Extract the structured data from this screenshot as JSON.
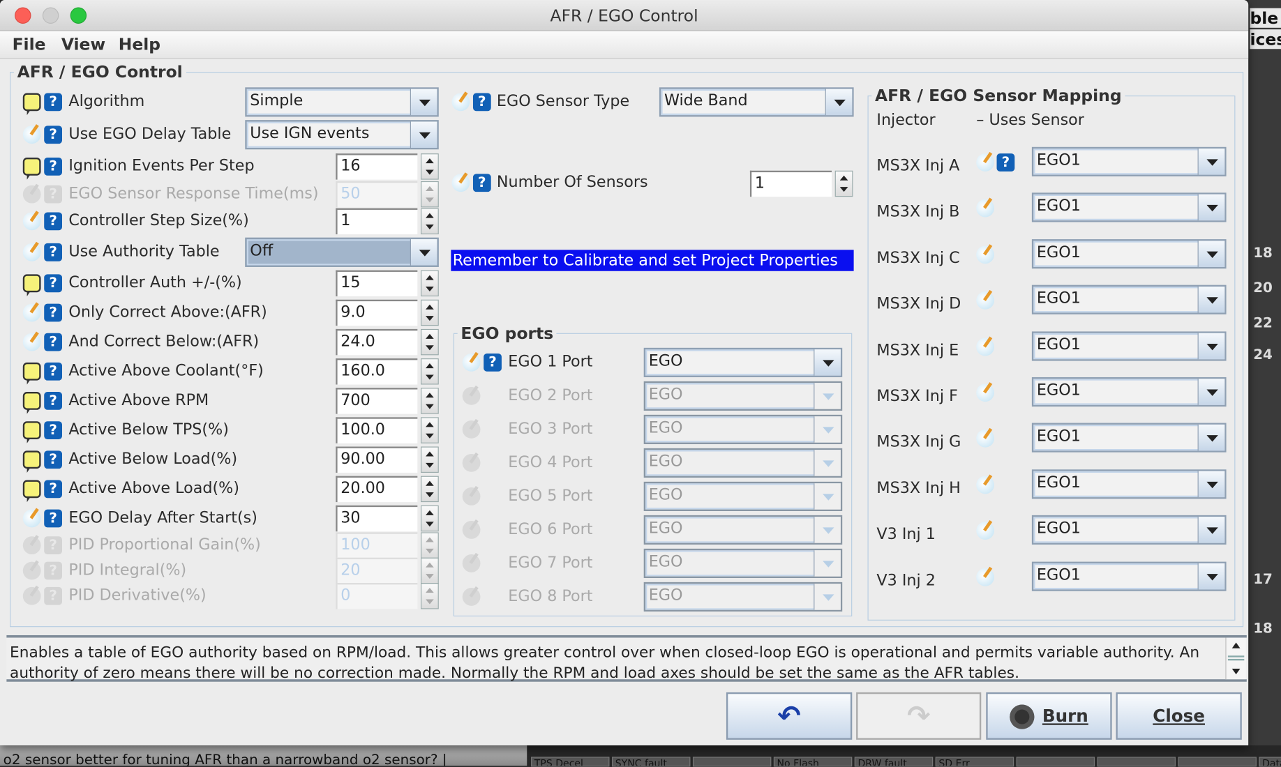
{
  "window": {
    "title": "AFR / EGO Control",
    "colors": {
      "close": "#fc5f57",
      "minimize": "#d0d0d0",
      "zoom": "#2ac840"
    }
  },
  "menu": [
    "File",
    "View",
    "Help"
  ],
  "main_group_title": "AFR / EGO Control",
  "left_rows": [
    {
      "label": "Algorithm",
      "icon": "comment",
      "kind": "combo",
      "value": "Simple"
    },
    {
      "label": "Use EGO Delay Table",
      "icon": "edit",
      "kind": "combo",
      "value": "Use IGN events"
    },
    {
      "label": "Ignition Events Per Step",
      "icon": "comment",
      "kind": "spin",
      "value": "16"
    },
    {
      "label": "EGO Sensor Response Time(ms)",
      "icon": "disabled",
      "kind": "spin",
      "value": "50",
      "disabled": true
    },
    {
      "label": "Controller Step Size(%)",
      "icon": "edit",
      "kind": "spin",
      "value": "1"
    },
    {
      "label": "Use Authority Table",
      "icon": "edit",
      "kind": "combo",
      "value": "Off",
      "selected": true
    },
    {
      "label": "Controller Auth +/-(%)",
      "icon": "comment",
      "kind": "spin",
      "value": "15"
    },
    {
      "label": "Only Correct Above:(AFR)",
      "icon": "edit",
      "kind": "spin",
      "value": "9.0"
    },
    {
      "label": "And Correct Below:(AFR)",
      "icon": "edit",
      "kind": "spin",
      "value": "24.0"
    },
    {
      "label": "Active Above Coolant(°F)",
      "icon": "comment",
      "kind": "spin",
      "value": "160.0"
    },
    {
      "label": "Active Above RPM",
      "icon": "comment",
      "kind": "spin",
      "value": "700"
    },
    {
      "label": "Active Below TPS(%)",
      "icon": "comment",
      "kind": "spin",
      "value": "100.0"
    },
    {
      "label": "Active Below Load(%)",
      "icon": "comment",
      "kind": "spin",
      "value": "90.00"
    },
    {
      "label": "Active Above Load(%)",
      "icon": "comment",
      "kind": "spin",
      "value": "20.00"
    },
    {
      "label": "EGO Delay After Start(s)",
      "icon": "edit",
      "kind": "spin",
      "value": "30"
    },
    {
      "label": "PID Proportional Gain(%)",
      "icon": "disabled",
      "kind": "spin",
      "value": "100",
      "disabled": true
    },
    {
      "label": "PID Integral(%)",
      "icon": "disabled",
      "kind": "spin",
      "value": "20",
      "disabled": true
    },
    {
      "label": "PID Derivative(%)",
      "icon": "disabled",
      "kind": "spin",
      "value": "0",
      "disabled": true
    }
  ],
  "sensor_type": {
    "label": "EGO Sensor Type",
    "value": "Wide Band"
  },
  "num_sensors": {
    "label": "Number Of Sensors",
    "value": "1"
  },
  "banner": "Remember to Calibrate and set Project Properties",
  "banner_color": "#0a0ff0",
  "ports": {
    "title": "EGO ports",
    "rows": [
      {
        "label": "EGO 1 Port",
        "value": "EGO",
        "disabled": false
      },
      {
        "label": "EGO 2 Port",
        "value": "EGO",
        "disabled": true
      },
      {
        "label": "EGO 3 Port",
        "value": "EGO",
        "disabled": true
      },
      {
        "label": "EGO 4 Port",
        "value": "EGO",
        "disabled": true
      },
      {
        "label": "EGO 5 Port",
        "value": "EGO",
        "disabled": true
      },
      {
        "label": "EGO 6 Port",
        "value": "EGO",
        "disabled": true
      },
      {
        "label": "EGO 7 Port",
        "value": "EGO",
        "disabled": true
      },
      {
        "label": "EGO 8 Port",
        "value": "EGO",
        "disabled": true
      }
    ]
  },
  "mapping": {
    "title": "AFR / EGO Sensor Mapping",
    "col1": "Injector",
    "col2": "– Uses Sensor",
    "rows": [
      {
        "label": "MS3X Inj A",
        "value": "EGO1"
      },
      {
        "label": "MS3X Inj B",
        "value": "EGO1"
      },
      {
        "label": "MS3X Inj C",
        "value": "EGO1"
      },
      {
        "label": "MS3X Inj D",
        "value": "EGO1"
      },
      {
        "label": "MS3X Inj E",
        "value": "EGO1"
      },
      {
        "label": "MS3X Inj F",
        "value": "EGO1"
      },
      {
        "label": "MS3X Inj G",
        "value": "EGO1"
      },
      {
        "label": "MS3X Inj H",
        "value": "EGO1"
      },
      {
        "label": "V3 Inj 1",
        "value": "EGO1"
      },
      {
        "label": "V3 Inj 2",
        "value": "EGO1"
      }
    ]
  },
  "description": "Enables a table of EGO authority based on RPM/load. This allows greater control over when closed-loop EGO is operational and permits variable authority. An authority of zero means there will be no correction made. Normally the RPM and load axes should be set the same as the AFR tables.",
  "buttons": {
    "burn": "Burn",
    "close": "Close"
  },
  "background": {
    "right_text": [
      "ble",
      "ices"
    ],
    "gauge_numbers": [
      "18",
      "20",
      "22",
      "24",
      "17",
      "18"
    ],
    "bottom_text": "o2 sensor better for tuning AFR than a narrowband o2 sensor? |",
    "status": [
      "TPS Decel",
      "SYNC fault",
      "",
      "No Flash",
      "DRW fault",
      "SD Err",
      "",
      "",
      "",
      "Data Lost"
    ]
  }
}
